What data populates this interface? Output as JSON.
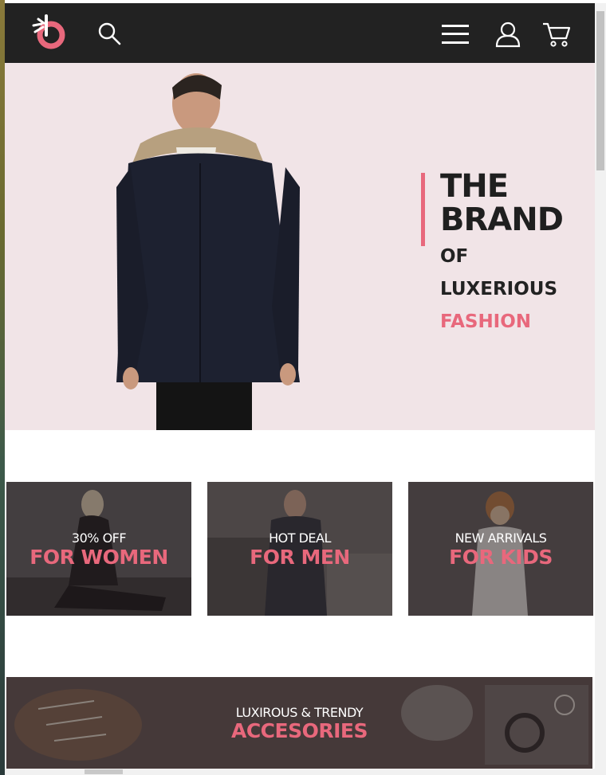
{
  "header": {
    "logo": "brand-logo",
    "icons": [
      "search-icon",
      "menu-icon",
      "user-icon",
      "cart-icon"
    ]
  },
  "hero": {
    "title_line1": "THE",
    "title_line2": "BRAND",
    "sub1": "OF",
    "sub2": "LUXERIOUS",
    "sub3": "FASHION"
  },
  "promos": [
    {
      "top": "30% OFF",
      "main": "FOR WOMEN"
    },
    {
      "top": "HOT DEAL",
      "main": "FOR MEN"
    },
    {
      "top": "NEW ARRIVALS",
      "main": "FOR KIDS"
    }
  ],
  "banner": {
    "top": "LUXIROUS & TRENDY",
    "main": "ACCESORIES"
  },
  "colors": {
    "accent": "#e8687c",
    "header_bg": "#222222",
    "hero_bg": "#f1e4e7"
  }
}
